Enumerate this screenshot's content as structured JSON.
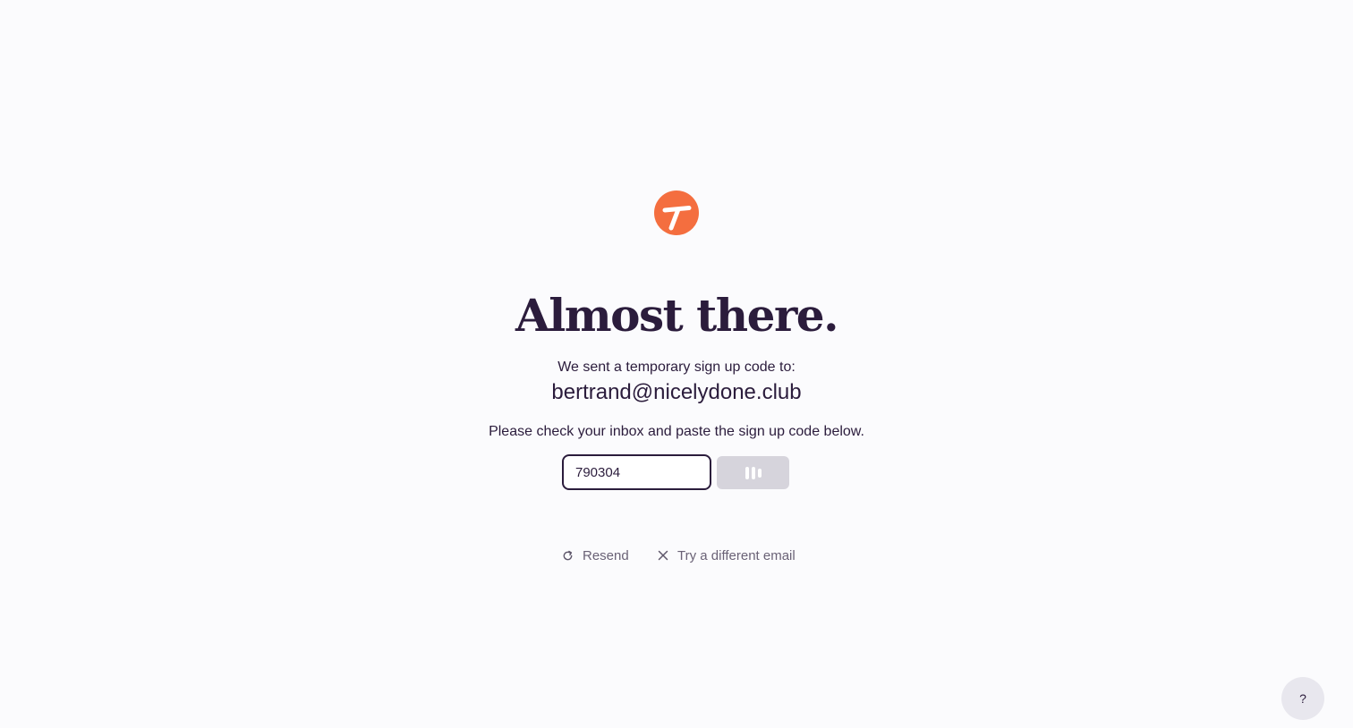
{
  "brand": {
    "logo_icon": "orange-circle-T-logo",
    "accent_color": "#f46e3f"
  },
  "heading": "Almost there.",
  "sent_text": "We sent a temporary sign up code to:",
  "email": "bertrand@nicelydone.club",
  "instructions": "Please check your inbox and paste the sign up code below.",
  "code_input": {
    "value": "790304",
    "placeholder": ""
  },
  "submit_button": {
    "state": "loading",
    "icon": "loading-bars-icon"
  },
  "links": {
    "resend": "Resend",
    "different_email": "Try a different email"
  },
  "help_button": {
    "label": "?"
  }
}
